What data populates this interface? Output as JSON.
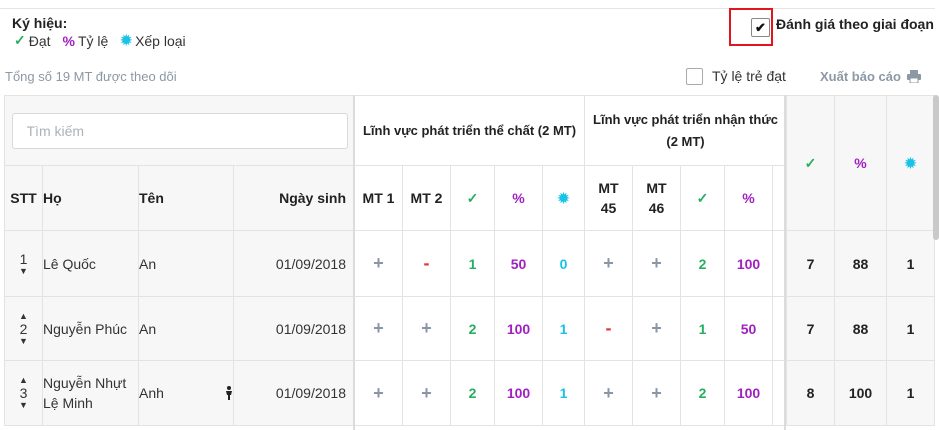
{
  "legend": {
    "title": "Ký hiệu:",
    "items": [
      {
        "icon": "check-icon",
        "symbol": "✓",
        "label": "Đạt",
        "color": "#27ae60"
      },
      {
        "icon": "percent-icon",
        "symbol": "%",
        "label": "Tỷ lệ",
        "color": "#a020c0"
      },
      {
        "icon": "badge-icon",
        "symbol": "✹",
        "label": "Xếp loại",
        "color": "#19c3e6"
      }
    ]
  },
  "stage_eval": {
    "label": "Đánh giá theo giai đoạn",
    "checked": true,
    "mark": "✔"
  },
  "summary": "Tổng số 19 MT được theo dõi",
  "rate_toggle": {
    "label": "Tỷ lệ trẻ đạt"
  },
  "export": {
    "label": "Xuất báo cáo"
  },
  "search": {
    "placeholder": "Tìm kiếm"
  },
  "columns": {
    "stt": "STT",
    "ho": "Họ",
    "ten": "Tên",
    "ngay_sinh": "Ngày sinh",
    "group1": "Lĩnh vực phát triển thể chất (2 MT)",
    "group2": "Lĩnh vực phát triển nhận thức (2 MT)",
    "g1_mt": [
      "MT 1",
      "MT 2"
    ],
    "g2_mt": [
      "MT 45",
      "MT 46"
    ],
    "sym_check": "✓",
    "sym_pct": "%",
    "sym_badge": "✹"
  },
  "rows": [
    {
      "stt": "1",
      "ho": "Lê Quốc",
      "ten": "An",
      "ngay_sinh": "01/09/2018",
      "up": false,
      "down": true,
      "gender_icon": false,
      "g1": [
        "+",
        "-"
      ],
      "g1_dat": "1",
      "g1_pct": "50",
      "g1_xl": "0",
      "g2": [
        "+",
        "+"
      ],
      "g2_dat": "2",
      "g2_pct": "100",
      "tot_dat": "7",
      "tot_pct": "88",
      "tot_xl": "1"
    },
    {
      "stt": "2",
      "ho": "Nguyễn Phúc",
      "ten": "An",
      "ngay_sinh": "01/09/2018",
      "up": true,
      "down": true,
      "gender_icon": false,
      "g1": [
        "+",
        "+"
      ],
      "g1_dat": "2",
      "g1_pct": "100",
      "g1_xl": "1",
      "g2": [
        "-",
        "+"
      ],
      "g2_dat": "1",
      "g2_pct": "50",
      "tot_dat": "7",
      "tot_pct": "88",
      "tot_xl": "1"
    },
    {
      "stt": "3",
      "ho": "Nguyễn Nhựt Lệ Minh",
      "ten": "Anh",
      "ngay_sinh": "01/09/2018",
      "up": true,
      "down": true,
      "gender_icon": true,
      "g1": [
        "+",
        "+"
      ],
      "g1_dat": "2",
      "g1_pct": "100",
      "g1_xl": "1",
      "g2": [
        "+",
        "+"
      ],
      "g2_dat": "2",
      "g2_pct": "100",
      "tot_dat": "8",
      "tot_pct": "100",
      "tot_xl": "1"
    }
  ]
}
